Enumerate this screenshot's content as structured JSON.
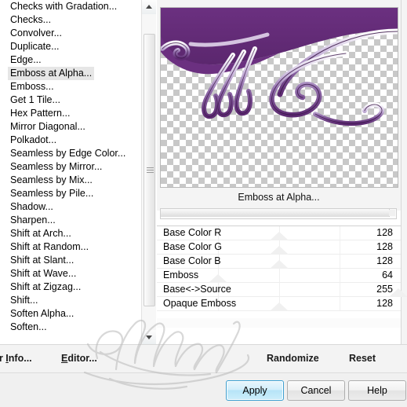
{
  "filter_list": {
    "items": [
      {
        "label": "Checks with Gradation...",
        "selected": false
      },
      {
        "label": "Checks...",
        "selected": false
      },
      {
        "label": "Convolver...",
        "selected": false
      },
      {
        "label": "Duplicate...",
        "selected": false
      },
      {
        "label": "Edge...",
        "selected": false
      },
      {
        "label": "Emboss at Alpha...",
        "selected": true
      },
      {
        "label": "Emboss...",
        "selected": false
      },
      {
        "label": "Get 1 Tile...",
        "selected": false
      },
      {
        "label": "Hex Pattern...",
        "selected": false
      },
      {
        "label": "Mirror Diagonal...",
        "selected": false
      },
      {
        "label": "Polkadot...",
        "selected": false
      },
      {
        "label": "Seamless by Edge Color...",
        "selected": false
      },
      {
        "label": "Seamless by Mirror...",
        "selected": false
      },
      {
        "label": "Seamless by Mix...",
        "selected": false
      },
      {
        "label": "Seamless by Pile...",
        "selected": false
      },
      {
        "label": "Shadow...",
        "selected": false
      },
      {
        "label": "Sharpen...",
        "selected": false
      },
      {
        "label": "Shift at Arch...",
        "selected": false
      },
      {
        "label": "Shift at Random...",
        "selected": false
      },
      {
        "label": "Shift at Slant...",
        "selected": false
      },
      {
        "label": "Shift at Wave...",
        "selected": false
      },
      {
        "label": "Shift at Zigzag...",
        "selected": false
      },
      {
        "label": "Shift...",
        "selected": false
      },
      {
        "label": "Soften Alpha...",
        "selected": false
      },
      {
        "label": "Soften...",
        "selected": false
      }
    ]
  },
  "scrollbar": {
    "up_icon": "scroll-up-arrow-icon",
    "down_icon": "scroll-down-arrow-icon"
  },
  "preview": {
    "filter_name": "Emboss at Alpha...",
    "artwork_colors": {
      "purple": "#6b3080",
      "purple_light": "#b49ad0",
      "highlight": "#ffffff",
      "outline": "#2a1133",
      "checker": "#c8c8c8"
    }
  },
  "params": {
    "rows": [
      {
        "label": "Base Color R",
        "value": "128",
        "thumb_pct": 50.0
      },
      {
        "label": "Base Color G",
        "value": "128",
        "thumb_pct": 50.0
      },
      {
        "label": "Base Color B",
        "value": "128",
        "thumb_pct": 50.0
      },
      {
        "label": "Emboss",
        "value": "64",
        "thumb_pct": 25.0
      },
      {
        "label": "Base<->Source",
        "value": "255",
        "thumb_pct": 99.0
      },
      {
        "label": "Opaque Emboss",
        "value": "128",
        "thumb_pct": 50.0
      }
    ]
  },
  "links": {
    "filter_info": "er Info...",
    "filter_info_accel": "I",
    "editor": "Editor...",
    "editor_accel": "E",
    "randomize": "Randomize",
    "reset": "Reset"
  },
  "buttons": {
    "apply": "Apply",
    "cancel": "Cancel",
    "help": "Help",
    "apply_accent": "#3c9fd0"
  },
  "watermark": {
    "text": "Manany"
  }
}
